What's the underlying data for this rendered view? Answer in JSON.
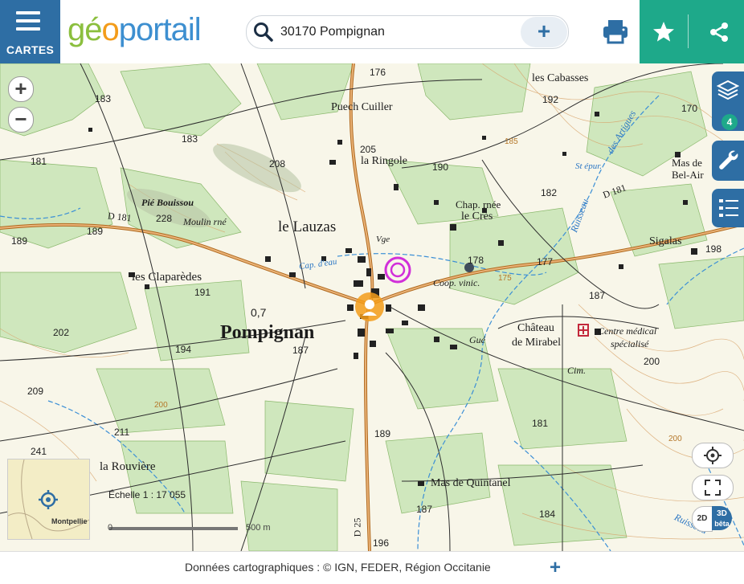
{
  "menu": {
    "label": "CARTES"
  },
  "logo": {
    "part1": "gé",
    "part2": "o",
    "part3": "portail"
  },
  "search": {
    "value": "30170 Pompignan"
  },
  "layers": {
    "count": "4"
  },
  "map_labels": {
    "places": [
      "Puech Cuiller",
      "la Ringole",
      "les Cabasses",
      "Mas de Bel-Air",
      "Pié Bouissou",
      "Moulin rné",
      "le Lauzas",
      "Chap. rnée",
      "le Crès",
      "Sigalas",
      "les Claparèdes",
      "Pompignan",
      "Château",
      "de Mirabel",
      "Centre médical",
      "spécialisé",
      "Coop. vinic.",
      "Gué",
      "Cim.",
      "la Rouvière",
      "Mas de Quintanel",
      "Montpellie",
      "Vge",
      "St épur.",
      "Cap. d'eau"
    ],
    "roads": [
      "D 181",
      "D 181",
      "D 25",
      "Ruisseau",
      "Ruisseau",
      "des Artigues"
    ],
    "elevations": [
      "176",
      "183",
      "181",
      "183",
      "208",
      "205",
      "190",
      "192",
      "170",
      "182",
      "198",
      "228",
      "189",
      "189",
      "191",
      "178",
      "177",
      "187",
      "202",
      "194",
      "187",
      "209",
      "211",
      "241",
      "189",
      "181",
      "187",
      "184",
      "196",
      "200",
      "0,7",
      "175",
      "185",
      "200",
      "200"
    ]
  },
  "scale": {
    "label": "Échelle 1 : 17 055",
    "zero": "0",
    "end": "500 m"
  },
  "dimension": {
    "d2": "2D",
    "d3": "3D",
    "beta": "bêta"
  },
  "footer": {
    "attribution": "Données cartographiques : ©  IGN,  FEDER,  Région Occitanie",
    "plus": "+"
  },
  "colors": {
    "header_blue": "#2e6ea4",
    "header_green": "#1ea98a",
    "marker": "#f39c1a",
    "poi": "#d12fd9"
  }
}
